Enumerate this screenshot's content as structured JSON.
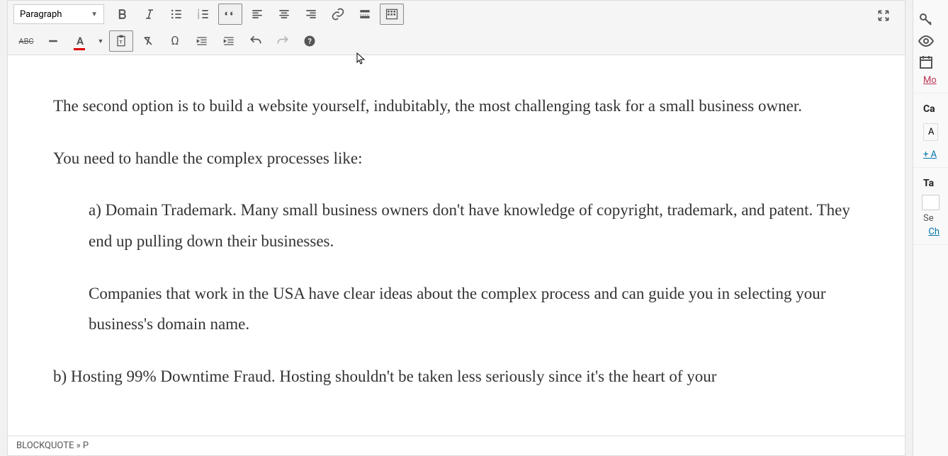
{
  "toolbar": {
    "format_label": "Paragraph"
  },
  "content": {
    "p1": "The second option is to build a website yourself, indubitably, the most challenging task for a small business owner.",
    "p2": "You need to handle the complex processes like:",
    "p3": "a) Domain Trademark. Many small business owners don't have knowledge of copyright, trademark, and patent. They end up pulling down their businesses.",
    "p4": "Companies that work in the USA have clear ideas about the complex process and can guide you in selecting your business's domain name.",
    "p5": "b) Hosting 99% Downtime Fraud. Hosting shouldn't be taken less seriously since it's the heart of your"
  },
  "status": {
    "path": "BLOCKQUOTE » P"
  },
  "sidebar": {
    "more": "Mo",
    "cat": "Ca",
    "a_label": "A",
    "add_link": "+ A",
    "ta": "Ta",
    "se": "Se",
    "ch": "Ch"
  }
}
